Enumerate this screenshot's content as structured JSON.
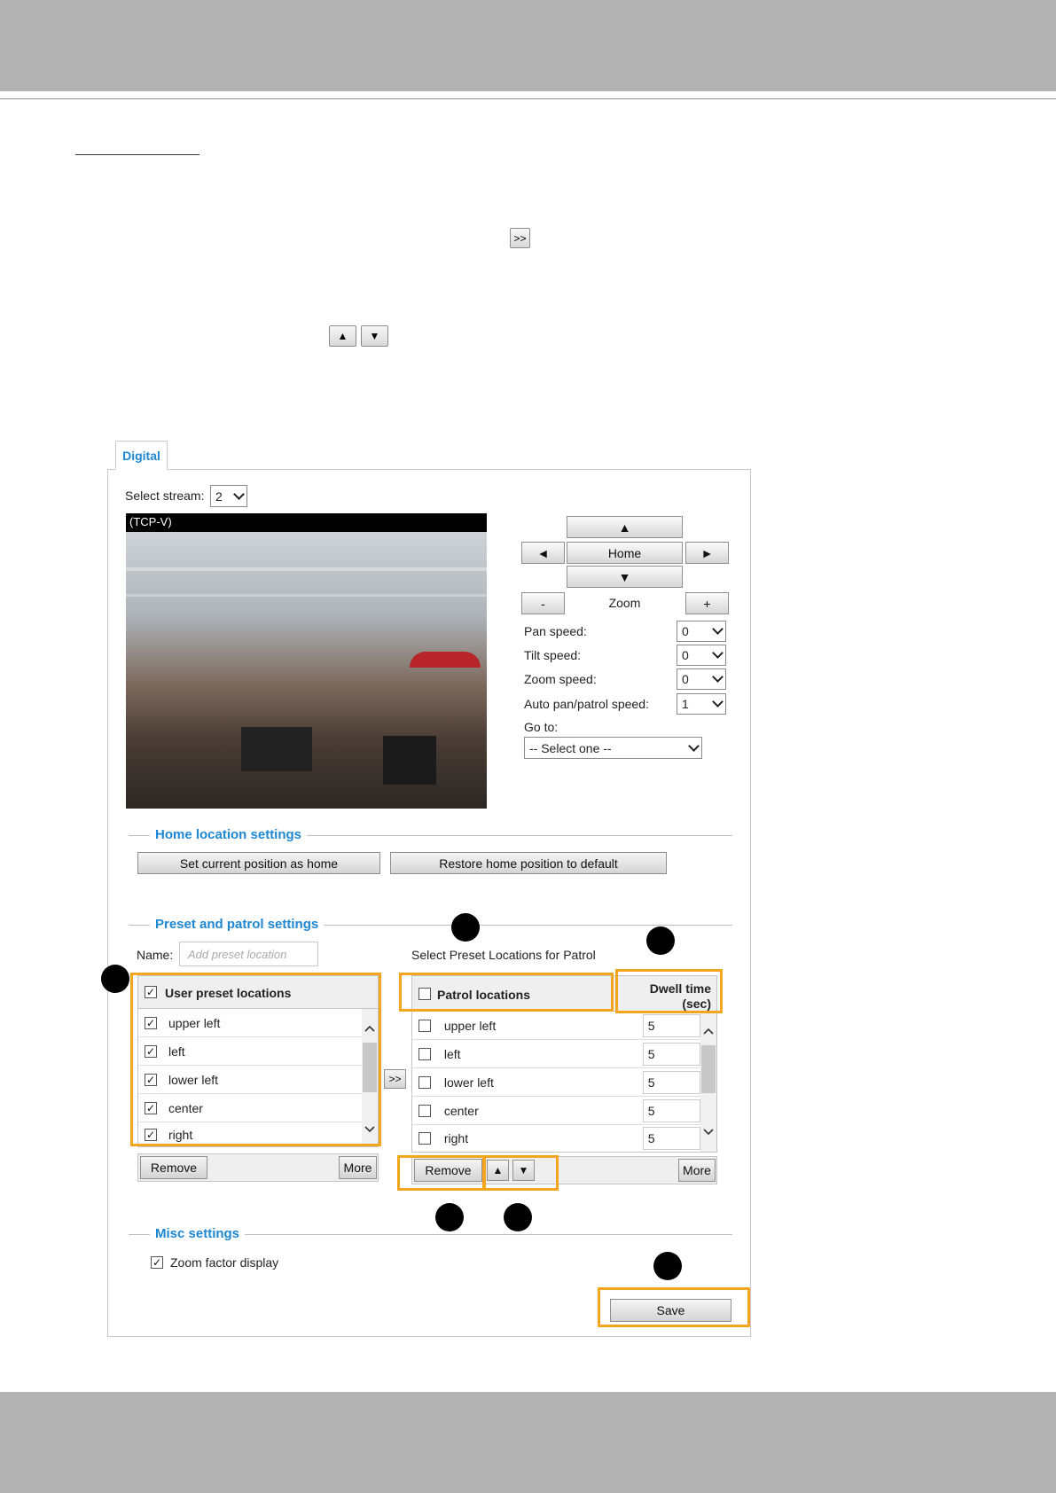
{
  "inline_buttons": {
    "add": ">>",
    "up": "▲",
    "down": "▼"
  },
  "tab": {
    "label": "Digital"
  },
  "stream": {
    "label": "Select stream:",
    "value": "2"
  },
  "video": {
    "label": "(TCP-V)"
  },
  "ptz": {
    "up": "▲",
    "left": "◄",
    "home": "Home",
    "right": "►",
    "down": "▼",
    "zoom_out": "-",
    "zoom_label": "Zoom",
    "zoom_in": "+",
    "pan_speed_label": "Pan speed:",
    "pan_speed": "0",
    "tilt_speed_label": "Tilt speed:",
    "tilt_speed": "0",
    "zoom_speed_label": "Zoom speed:",
    "zoom_speed": "0",
    "auto_speed_label": "Auto pan/patrol speed:",
    "auto_speed": "1",
    "goto_label": "Go to:",
    "goto_value": "-- Select one --"
  },
  "home": {
    "title": "Home location settings",
    "set_button": "Set current position as home",
    "restore_button": "Restore home position to default"
  },
  "preset": {
    "title": "Preset and patrol settings",
    "name_label": "Name:",
    "name_placeholder": "Add preset location",
    "patrol_title": "Select Preset Locations for Patrol",
    "user_header": "User preset locations",
    "user_items": [
      "upper left",
      "left",
      "lower left",
      "center",
      "right"
    ],
    "transfer": ">>",
    "patrol_header": "Patrol locations",
    "dwell_header_1": "Dwell time",
    "dwell_header_2": "(sec)",
    "patrol_items": [
      {
        "label": "upper left",
        "dwell": "5"
      },
      {
        "label": "left",
        "dwell": "5"
      },
      {
        "label": "lower left",
        "dwell": "5"
      },
      {
        "label": "center",
        "dwell": "5"
      },
      {
        "label": "right",
        "dwell": "5"
      }
    ],
    "remove": "Remove",
    "more": "More",
    "up": "▲",
    "down": "▼"
  },
  "misc": {
    "title": "Misc settings",
    "zoom_factor": "Zoom factor display"
  },
  "save": "Save",
  "check_mark": "✓"
}
